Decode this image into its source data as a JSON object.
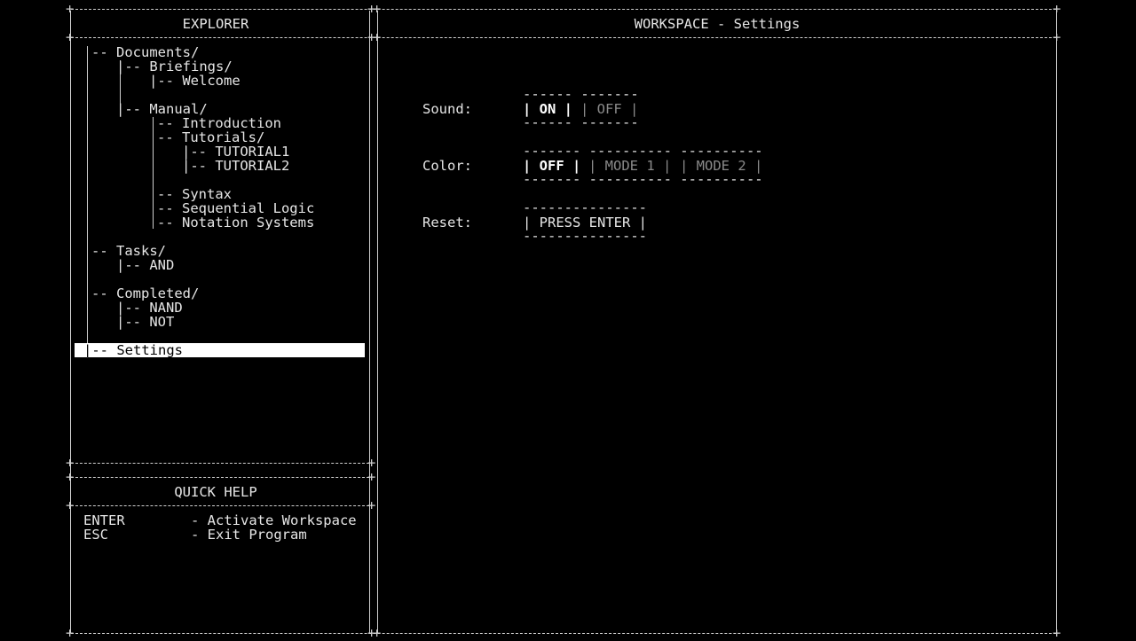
{
  "explorer": {
    "title": "EXPLORER",
    "tree": {
      "documents": "-- Documents/",
      "briefings": "|-- Briefings/",
      "welcome": "|-- Welcome",
      "manual": "|-- Manual/",
      "introduction": "-- Introduction",
      "tutorials": "-- Tutorials/",
      "tutorial1": "|-- TUTORIAL1",
      "tutorial2": "|-- TUTORIAL2",
      "syntax": "-- Syntax",
      "sequential_logic": "-- Sequential Logic",
      "notation_systems": "-- Notation Systems",
      "tasks": "-- Tasks/",
      "and": "|-- AND",
      "completed": "-- Completed/",
      "nand": "|-- NAND",
      "not": "|-- NOT",
      "settings": "|-- Settings"
    }
  },
  "quick_help": {
    "title": "QUICK HELP",
    "rows": [
      {
        "key": "ENTER",
        "desc": "- Activate Workspace"
      },
      {
        "key": "ESC",
        "desc": "- Exit Program"
      }
    ]
  },
  "workspace": {
    "title": "WORKSPACE - Settings",
    "sound": {
      "label": "Sound:",
      "top": "------ -------",
      "on": "| ON |",
      "off": "| OFF |",
      "bottom": "------ -------"
    },
    "color": {
      "label": "Color:",
      "top": "------- ---------- ----------",
      "off": "| OFF |",
      "mode1": "| MODE 1 |",
      "mode2": "| MODE 2 |",
      "bottom": "------- ---------- ----------"
    },
    "reset": {
      "label": "Reset:",
      "top": "---------------",
      "button": "| PRESS ENTER |",
      "bottom": "---------------"
    }
  },
  "colors": {
    "background": "#000000",
    "text": "#e6e6e6",
    "dim_text": "#8a8a8a",
    "selection": "#ffffff"
  }
}
